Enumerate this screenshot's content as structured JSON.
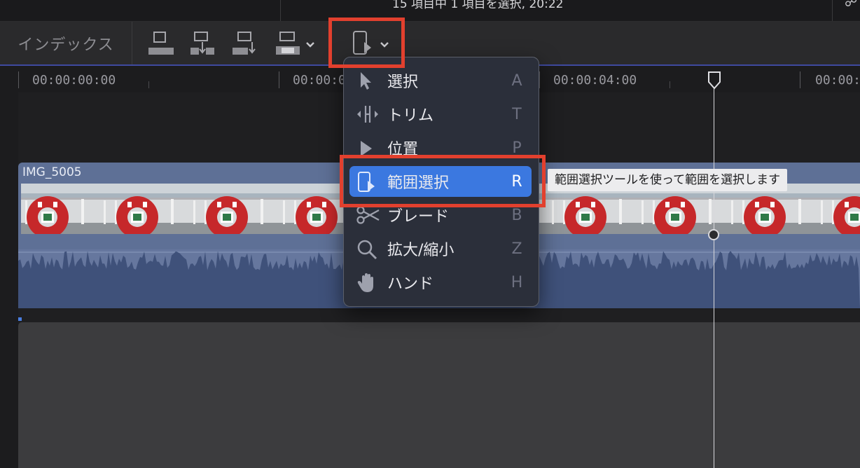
{
  "header": {
    "status_text": "15 項目中 1 項目を選択, 20:22",
    "right_icon": "share-icon"
  },
  "toolbar": {
    "index_label": "インデックス",
    "tools": [
      {
        "name": "connect-clip-icon"
      },
      {
        "name": "insert-clip-icon"
      },
      {
        "name": "append-clip-icon"
      },
      {
        "name": "overwrite-clip-icon"
      },
      {
        "name": "range-select-tool-icon"
      }
    ]
  },
  "ruler": {
    "timecodes": [
      "00:00:00:00",
      "00:00:0",
      "00:00:04:00",
      "00:00:"
    ]
  },
  "timeline": {
    "clip_title": "IMG_5005"
  },
  "tool_menu": {
    "items": [
      {
        "label": "選択",
        "key": "A",
        "icon": "arrow-pointer-icon",
        "selected": false
      },
      {
        "label": "トリム",
        "key": "T",
        "icon": "trim-icon",
        "selected": false
      },
      {
        "label": "位置",
        "key": "P",
        "icon": "position-arrow-icon",
        "selected": false
      },
      {
        "label": "範囲選択",
        "key": "R",
        "icon": "range-select-icon",
        "selected": true
      },
      {
        "label": "ブレード",
        "key": "B",
        "icon": "scissors-icon",
        "selected": false
      },
      {
        "label": "拡大/縮小",
        "key": "Z",
        "icon": "magnifier-icon",
        "selected": false
      },
      {
        "label": "ハンド",
        "key": "H",
        "icon": "hand-icon",
        "selected": false
      }
    ]
  },
  "tooltip": {
    "text": "範囲選択ツールを使って範囲を選択します"
  },
  "colors": {
    "highlight": "#e2402e",
    "menu_selected": "#3b78e0",
    "clip_blue": "#5e7096"
  }
}
